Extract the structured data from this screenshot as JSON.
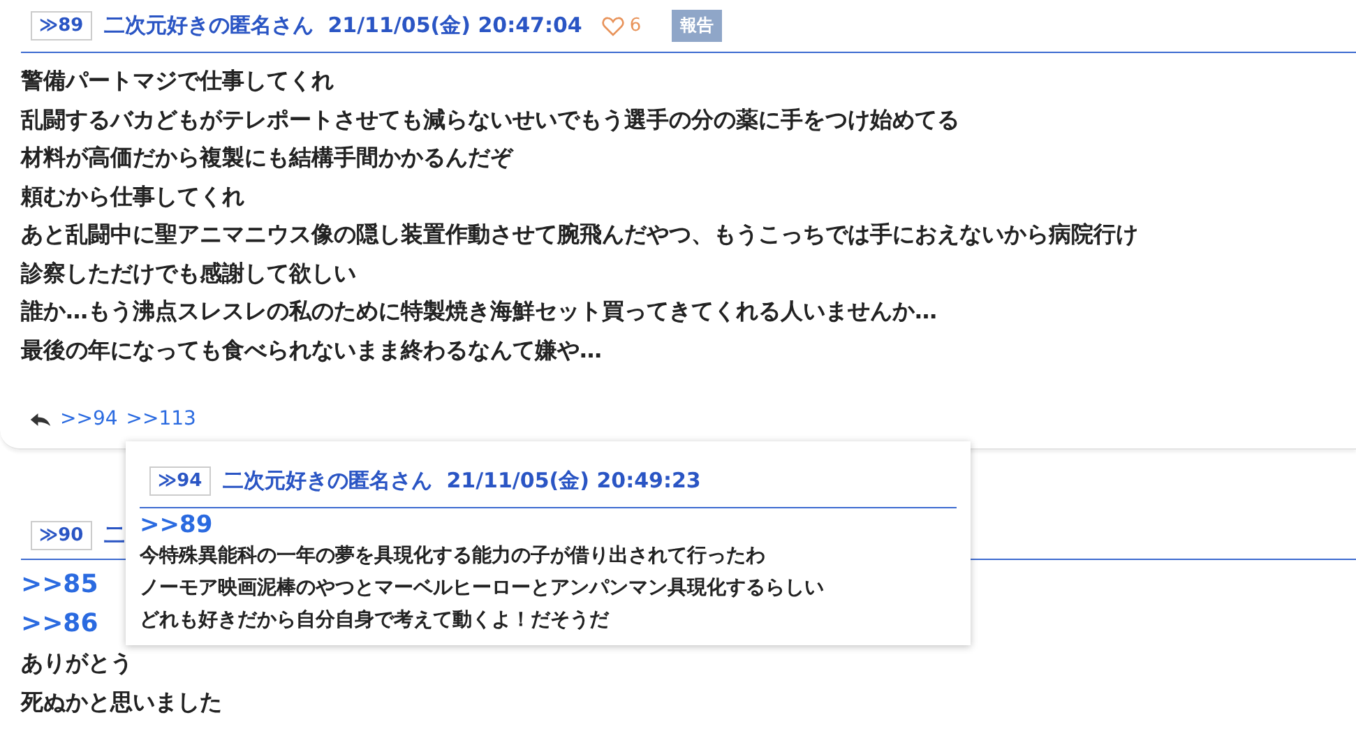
{
  "posts": [
    {
      "number": "≫89",
      "name": "二次元好きの匿名さん",
      "date": "21/11/05(金) 20:47:04",
      "likes": "6",
      "report": "報告",
      "lines": [
        {
          "kind": "text",
          "text": "警備パートマジで仕事してくれ"
        },
        {
          "kind": "text",
          "text": "乱闘するバカどもがテレポートさせても減らないせいでもう選手の分の薬に手をつけ始めてる"
        },
        {
          "kind": "text",
          "text": "材料が高価だから複製にも結構手間かかるんだぞ"
        },
        {
          "kind": "text",
          "text": "頼むから仕事してくれ"
        },
        {
          "kind": "text",
          "text": "あと乱闘中に聖アニマニウス像の隠し装置作動させて腕飛んだやつ、もうこっちでは手におえないから病院行け"
        },
        {
          "kind": "text",
          "text": "診察しただけでも感謝して欲しい"
        },
        {
          "kind": "text",
          "text": "誰か…もう沸点スレスレの私のために特製焼き海鮮セット買ってきてくれる人いませんか…"
        },
        {
          "kind": "text",
          "text": "最後の年になっても食べられないまま終わるなんて嫌や…"
        }
      ],
      "replies": [
        ">>94",
        ">>113"
      ]
    },
    {
      "number": "≫90",
      "name": "二",
      "lines": [
        {
          "kind": "anchor",
          "text": ">>85"
        },
        {
          "kind": "anchor",
          "text": ">>86"
        },
        {
          "kind": "text",
          "text": "ありがとう"
        },
        {
          "kind": "text",
          "text": "死ぬかと思いました"
        }
      ]
    }
  ],
  "popup": {
    "number": "≫94",
    "name": "二次元好きの匿名さん",
    "date": "21/11/05(金) 20:49:23",
    "lines": [
      {
        "kind": "anchor",
        "text": ">>89"
      },
      {
        "kind": "text",
        "text": "今特殊異能科の一年の夢を具現化する能力の子が借り出されて行ったわ"
      },
      {
        "kind": "text",
        "text": "ノーモア映画泥棒のやつとマーベルヒーローとアンパンマン具現化するらしい"
      },
      {
        "kind": "text",
        "text": "どれも好きだから自分自身で考えて動くよ！だそうだ"
      }
    ]
  }
}
